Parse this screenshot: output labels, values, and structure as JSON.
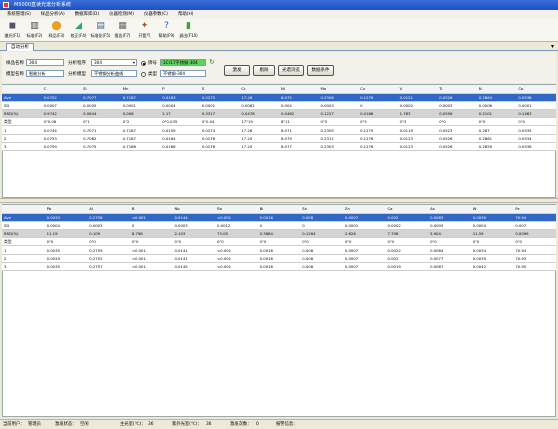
{
  "window": {
    "title": "M5000直读光谱分析系统"
  },
  "menu": [
    "系统管理(S)",
    "样品分析(A)",
    "数据库库(D)",
    "仪器检测(M)",
    "仪器参数(C)",
    "帮助(H)"
  ],
  "toolbar": [
    {
      "label": "激光(F1)",
      "icon": "laser-icon",
      "glyph": "◼",
      "color": "#556"
    },
    {
      "label": "标准(F2)",
      "icon": "standard-icon",
      "glyph": "▥",
      "color": "#444"
    },
    {
      "label": "样品(F3)",
      "icon": "sample-icon",
      "glyph": "⬤",
      "color": "#e8a020"
    },
    {
      "label": "校正(F4)",
      "icon": "calibrate-icon",
      "glyph": "◢",
      "color": "#2a6"
    },
    {
      "label": "标准化(F5)",
      "icon": "standardize-icon",
      "glyph": "▤",
      "color": "#469"
    },
    {
      "label": "报告(F7)",
      "icon": "report-icon",
      "glyph": "▦",
      "color": "#666"
    },
    {
      "label": "开氩气",
      "icon": "argon-icon",
      "glyph": "✦",
      "color": "#a52"
    },
    {
      "label": "帮助(F9)",
      "icon": "help-icon",
      "glyph": "?",
      "color": "#1f5fd0"
    },
    {
      "label": "退出(F10)",
      "icon": "exit-icon",
      "glyph": "▮",
      "color": "#3a3"
    }
  ],
  "tab": {
    "label": "自动分析"
  },
  "form": {
    "sample_name_label": "样品名称",
    "sample_name": "304",
    "program_label": "分析程序",
    "program": "304",
    "model_label": "模型名称",
    "model": "智能分析",
    "analysis_model_label": "分析模型",
    "analysis_model": "不锈钢分析曲线",
    "grade_label": "牌号",
    "grade": "1Cr17不锈钢-304",
    "type_label": "类型",
    "type": "不锈钢-304"
  },
  "buttons": {
    "excite": "激发",
    "delete": "剔除",
    "spectrum": "光谱浏览",
    "data_options": "数据条件"
  },
  "table1": {
    "columns": [
      "",
      "C",
      "Si",
      "Mn",
      "P",
      "S",
      "Cr",
      "Ni",
      "Mo",
      "Cu",
      "V",
      "Ti",
      "N",
      "Co"
    ],
    "rows": [
      {
        "style": "sel",
        "cells": [
          "Ave",
          "0.0752",
          "0.7077",
          "0.7187",
          "0.0163",
          "0.0275",
          "17.26",
          "8.075",
          "0.2306",
          "0.1276",
          "0.0121",
          "0.0526",
          "0.2864",
          "0.0538"
        ]
      },
      {
        "style": "w",
        "cells": [
          "SD",
          "0.0007",
          "0.0005",
          "0.0001",
          "0.0004",
          "0.0001",
          "0.0082",
          "0.004",
          "0.0003",
          "0",
          "0.0002",
          "0.0003",
          "0.0006",
          "0.0001"
        ]
      },
      {
        "style": "shade",
        "cells": [
          "RSD(%)",
          "0.9742",
          "0.0644",
          "0.006",
          "2.17",
          "0.3317",
          "0.0478",
          "0.0462",
          "0.1227",
          "0.0186",
          "1.783",
          "0.0556",
          "0.2101",
          "0.1463"
        ]
      },
      {
        "style": "w",
        "cells": [
          "类型",
          "0\"0.06",
          "0\"1",
          "0\"2",
          "0\"0.035",
          "0\"0.04",
          "17\"19",
          "8\"11",
          "0\"3",
          "0\"3",
          "0\"3",
          "0\"0",
          "0\"0",
          "0\"0"
        ]
      },
      {
        "style": "w",
        "cells": [
          "1",
          "0.0744",
          "0.7071",
          "0.7187",
          "0.0159",
          "0.0274",
          "17.26",
          "8.071",
          "0.2305",
          "0.1275",
          "0.0119",
          "0.0523",
          "0.287",
          "0.0535"
        ]
      },
      {
        "style": "w",
        "cells": [
          "2",
          "0.0753",
          "0.7082",
          "0.7187",
          "0.0164",
          "0.0276",
          "17.25",
          "8.079",
          "0.2311",
          "0.1276",
          "0.0123",
          "0.0526",
          "0.2861",
          "0.0534"
        ]
      },
      {
        "style": "w",
        "cells": [
          "3",
          "0.0759",
          "0.7075",
          "0.7186",
          "0.0166",
          "0.0276",
          "17.25",
          "8.077",
          "0.2303",
          "0.1276",
          "0.0123",
          "0.0526",
          "0.2859",
          "0.0536"
        ]
      }
    ]
  },
  "table2": {
    "columns": [
      "",
      "Pb",
      "Al",
      "B",
      "Nb",
      "Sb",
      "Bi",
      "Sn",
      "Zn",
      "Ca",
      "As",
      "W",
      "Fe"
    ],
    "rows": [
      {
        "style": "sel",
        "cells": [
          "Ave",
          "0.0033",
          "0.2758",
          "<0.001",
          "0.0144",
          "<0.001",
          "0.0016",
          "0.008",
          "0.0007",
          "0.002",
          "0.0083",
          "0.0039",
          "70.94"
        ]
      },
      {
        "style": "w",
        "cells": [
          "SD",
          "0.0004",
          "0.0003",
          "0",
          "0.0003",
          "0.0012",
          "0",
          "0",
          "0.0001",
          "0.0002",
          "0.0005",
          "0.0004",
          "0.007"
        ]
      },
      {
        "style": "shade",
        "cells": [
          "RSD(%)",
          "11.19",
          "0.109",
          "8.798",
          "2.103",
          "73.05",
          "0.3684",
          "0.1264",
          "2.626",
          "7.798",
          "5.904",
          "11.59",
          "0.0099"
        ]
      },
      {
        "style": "w",
        "cells": [
          "类型",
          "0\"0",
          "0\"0",
          "0\"0",
          "0\"0",
          "0\"0",
          "0\"0",
          "0\"0",
          "0\"0",
          "0\"0",
          "0\"0",
          "0\"0",
          "0\"0"
        ]
      },
      {
        "style": "w",
        "cells": [
          "1",
          "0.0035",
          "0.2759",
          "<0.001",
          "0.0141",
          "<0.001",
          "0.0016",
          "0.008",
          "0.0007",
          "0.0022",
          "0.0084",
          "0.0034",
          "70.94"
        ]
      },
      {
        "style": "w",
        "cells": [
          "2",
          "0.0029",
          "0.2752",
          "<0.001",
          "0.0147",
          "<0.001",
          "0.0016",
          "0.008",
          "0.0007",
          "0.002",
          "0.0077",
          "0.0039",
          "70.93"
        ]
      },
      {
        "style": "w",
        "cells": [
          "3",
          "0.0035",
          "0.2757",
          "<0.001",
          "0.0145",
          "<0.001",
          "0.0016",
          "0.008",
          "0.0007",
          "0.0019",
          "0.0087",
          "0.0042",
          "70.95"
        ]
      }
    ]
  },
  "status": {
    "user_label": "当前用户：",
    "user": "管理员",
    "excite_state_label": "激发状态：",
    "excite_state": "空闲",
    "main_pressure_label": "主光室(℃)：",
    "main_pressure": "36",
    "uv_label": "紫外光室(℃)：",
    "uv": "36",
    "excite_count_label": "激发次数：",
    "excite_count": "0",
    "alarm_label": "报警信息："
  }
}
